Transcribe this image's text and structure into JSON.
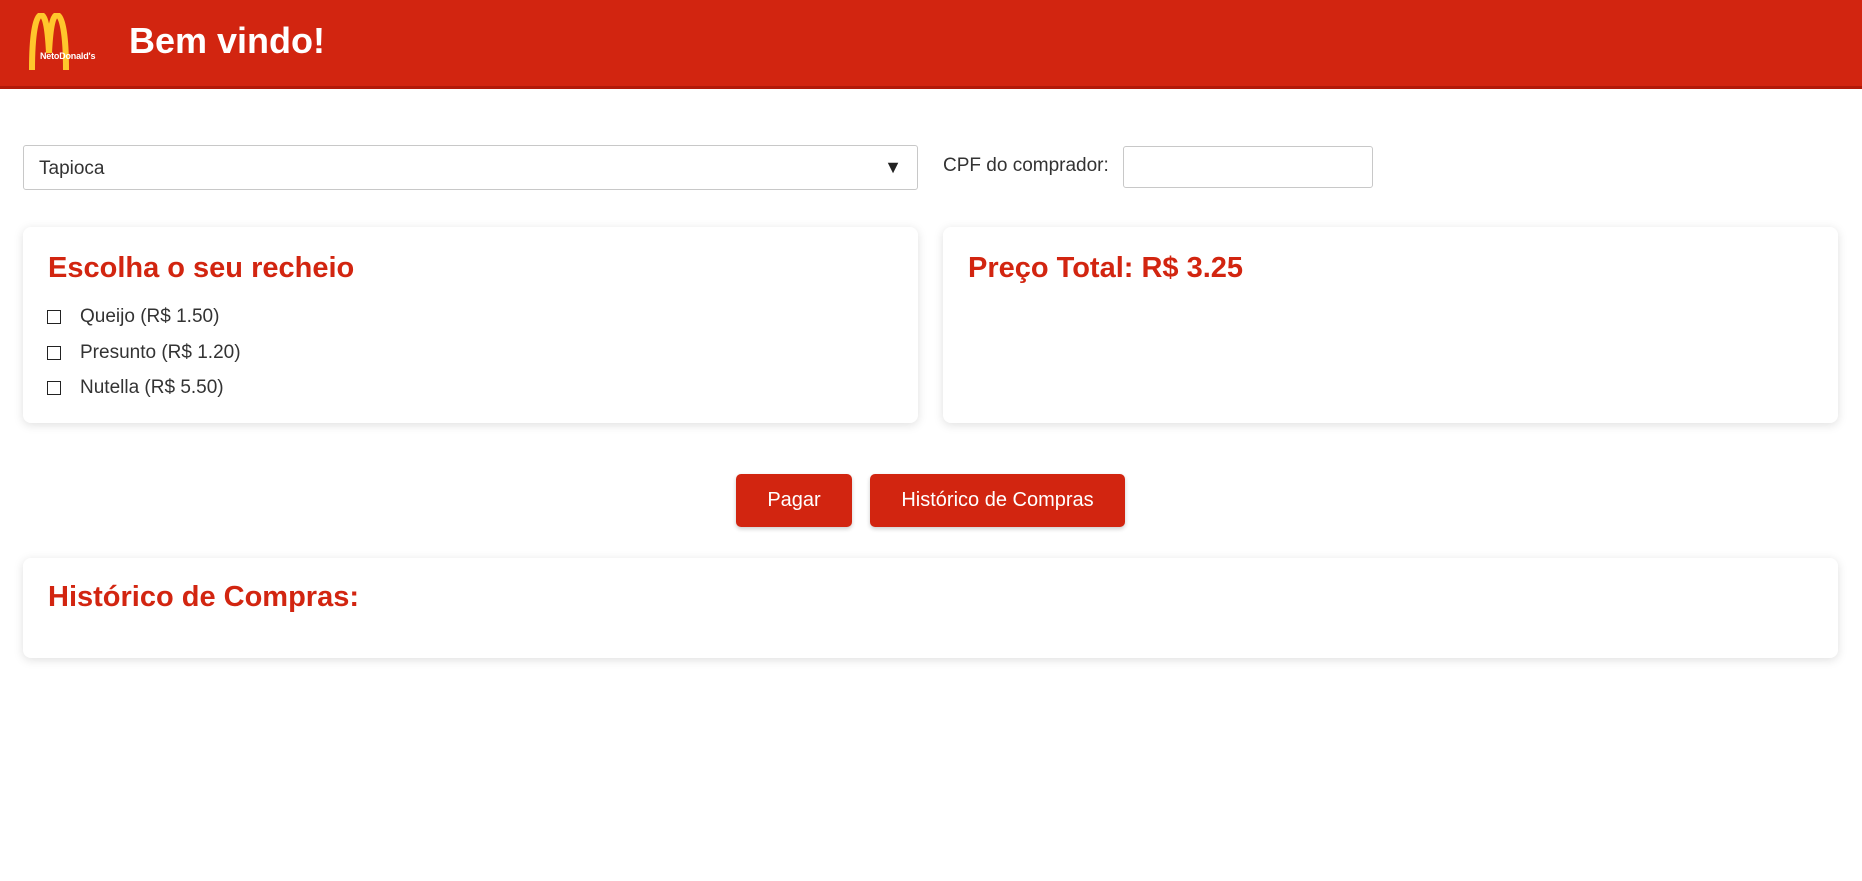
{
  "header": {
    "logo_text": "NetoDonald's",
    "title": "Bem vindo!"
  },
  "product_select": {
    "selected": "Tapioca"
  },
  "cpf": {
    "label": "CPF do comprador:",
    "value": "",
    "placeholder": ""
  },
  "fillings": {
    "title": "Escolha o seu recheio",
    "items": [
      {
        "label": "Queijo (R$ 1.50)",
        "checked": false
      },
      {
        "label": "Presunto (R$ 1.20)",
        "checked": false
      },
      {
        "label": "Nutella (R$ 5.50)",
        "checked": false
      }
    ]
  },
  "total": {
    "title": "Preço Total: R$ 3.25"
  },
  "actions": {
    "pay_label": "Pagar",
    "history_label": "Histórico de Compras"
  },
  "history": {
    "title": "Histórico de Compras:"
  },
  "colors": {
    "brand_red": "#d22510",
    "arches_yellow": "#ffc72c"
  },
  "icons": {
    "logo": "golden-arches-icon",
    "select_arrow": "dropdown-triangle-icon",
    "checkbox": "checkbox-icon"
  }
}
